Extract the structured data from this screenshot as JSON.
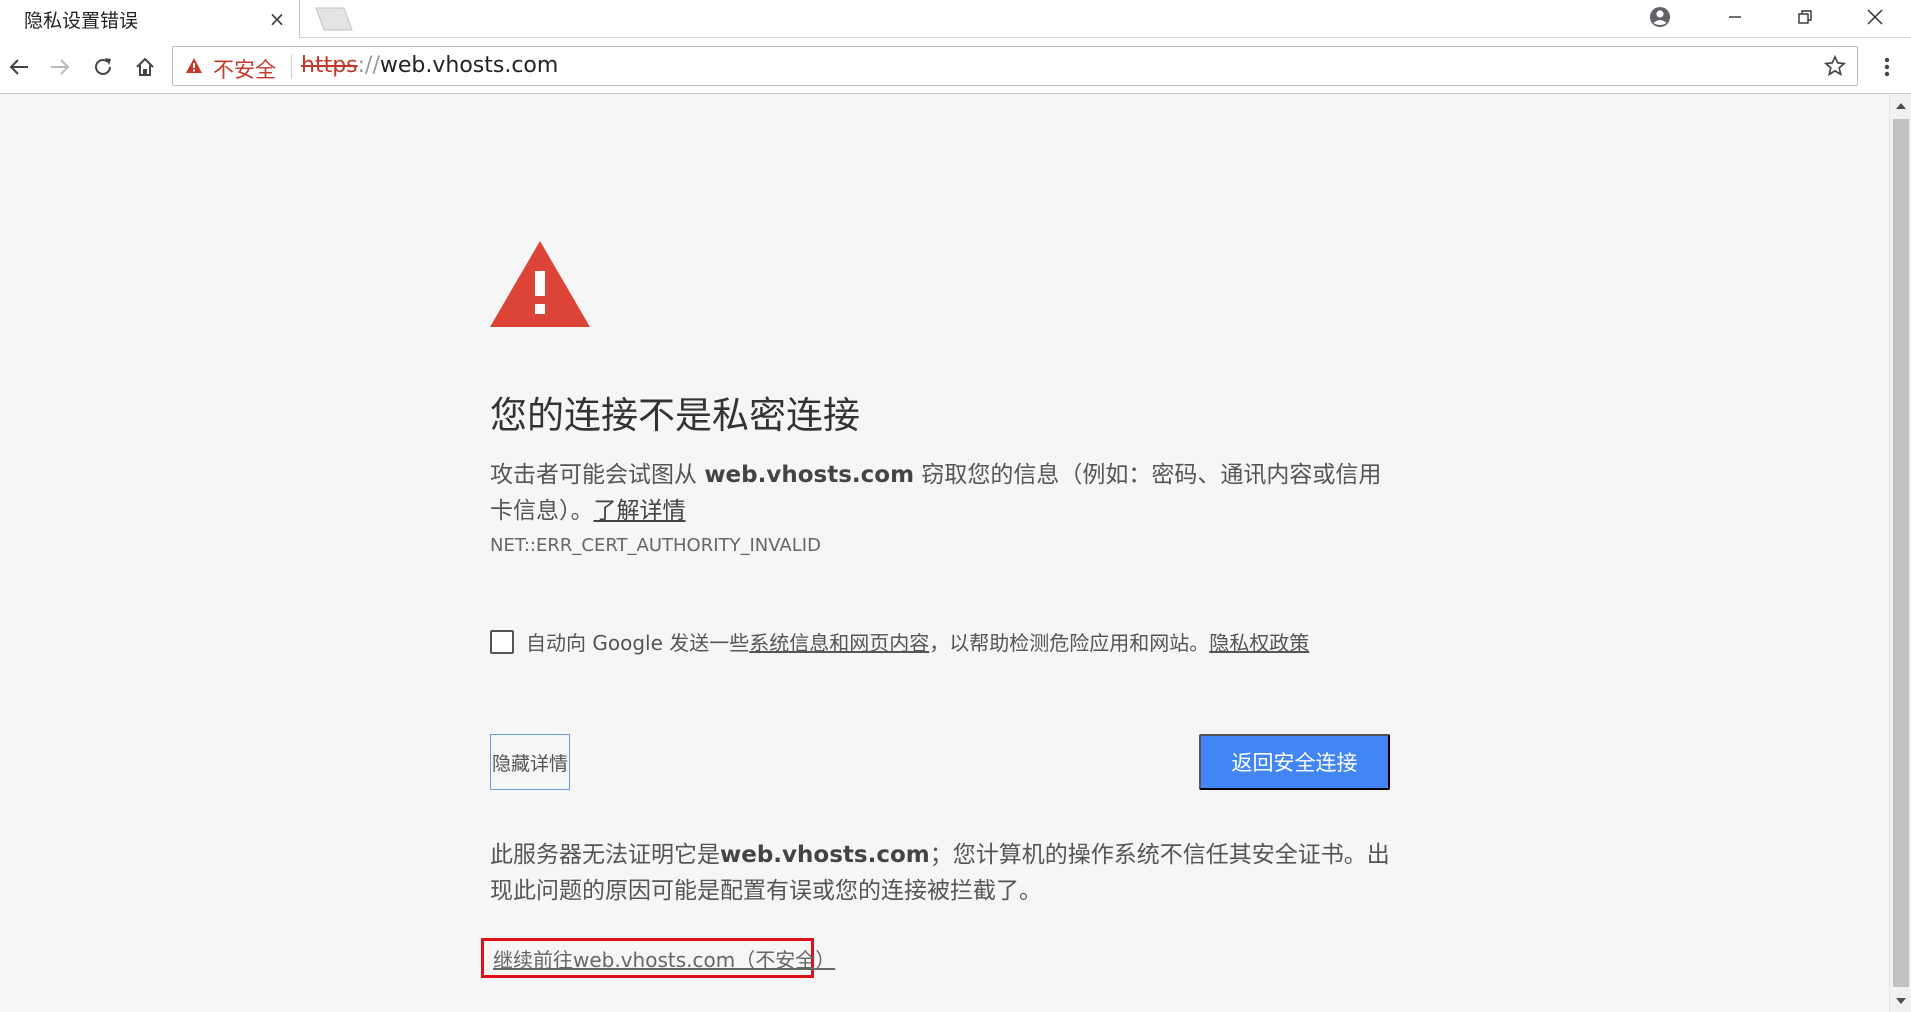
{
  "tab": {
    "title": "隐私设置错误",
    "close": "×"
  },
  "toolbar": {
    "security_label": "不安全",
    "url_scheme": "https",
    "url_sep": "://",
    "url_host": "web.vhosts.com"
  },
  "page": {
    "heading": "您的连接不是私密连接",
    "explain_pre": "攻击者可能会试图从 ",
    "explain_host": "web.vhosts.com",
    "explain_post": " 窃取您的信息（例如：密码、通讯内容或信用卡信息）。",
    "learn_more": "了解详情",
    "error_code": "NET::ERR_CERT_AUTHORITY_INVALID",
    "optin_pre": "自动向 Google 发送一些",
    "optin_link": "系统信息和网页内容",
    "optin_post": "，以帮助检测危险应用和网站。",
    "privacy_link": "隐私权政策",
    "hide_details": "隐藏详情",
    "back_to_safety": "返回安全连接",
    "details_pre": "此服务器无法证明它是",
    "details_host": "web.vhosts.com",
    "details_post": "；您计算机的操作系统不信任其安全证书。出现此问题的原因可能是配置有误或您的连接被拦截了。",
    "proceed_link": "继续前往web.vhosts.com（不安全）"
  },
  "colors": {
    "warning_red": "#db4437",
    "not_secure_red": "#c5372c",
    "primary_button": "#4285f4",
    "highlight_box": "#e0101b"
  },
  "icons": [
    "close-icon",
    "new-tab-icon",
    "profile-icon",
    "minimize-icon",
    "maximize-icon",
    "window-close-icon",
    "back-arrow-icon",
    "forward-arrow-icon",
    "reload-icon",
    "home-icon",
    "warning-triangle-icon",
    "star-icon",
    "menu-dots-icon"
  ]
}
